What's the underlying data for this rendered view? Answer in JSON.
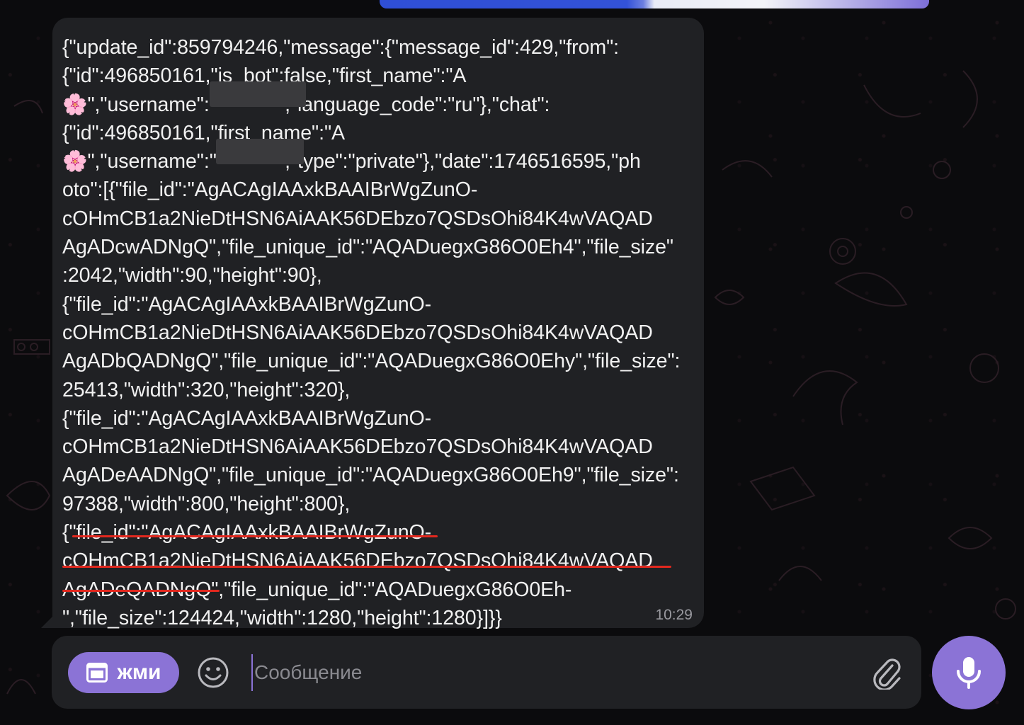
{
  "chat": {
    "message": {
      "lines": [
        "{\"update_id\":859794246,\"message\":{\"message_id\":429,\"from\":",
        "{\"id\":496850161,\"is_bot\":false,\"first_name\":\"A",
        "🌸\",\"username\":\"           \",\"language_code\":\"ru\"},\"chat\":",
        "{\"id\":496850161,\"first_name\":\"A",
        "🌸\",\"username\":\"           \",\"type\":\"private\"},\"date\":1746516595,\"ph",
        "oto\":[{\"file_id\":\"AgACAgIAAxkBAAIBrWgZunO-",
        "cOHmCB1a2NieDtHSN6AiAAK56DEbzo7QSDsOhi84K4wVAQAD",
        "AgADcwADNgQ\",\"file_unique_id\":\"AQADuegxG86O0Eh4\",\"file_size\"",
        ":2042,\"width\":90,\"height\":90},",
        "{\"file_id\":\"AgACAgIAAxkBAAIBrWgZunO-",
        "cOHmCB1a2NieDtHSN6AiAAK56DEbzo7QSDsOhi84K4wVAQAD",
        "AgADbQADNgQ\",\"file_unique_id\":\"AQADuegxG86O0Ehy\",\"file_size\":",
        "25413,\"width\":320,\"height\":320},",
        "{\"file_id\":\"AgACAgIAAxkBAAIBrWgZunO-",
        "cOHmCB1a2NieDtHSN6AiAAK56DEbzo7QSDsOhi84K4wVAQAD",
        "AgADeAADNgQ\",\"file_unique_id\":\"AQADuegxG86O0Eh9\",\"file_size\":",
        "97388,\"width\":800,\"height\":800},",
        "{\"file_id\":\"AgACAgIAAxkBAAIBrWgZunO-",
        "cOHmCB1a2NieDtHSN6AiAAK56DEbzo7QSDsOhi84K4wVAQAD",
        "AgADeQADNgQ\",\"file_unique_id\":\"AQADuegxG86O0Eh-",
        "\",\"file_size\":124424,\"width\":1280,\"height\":1280}]}}"
      ],
      "time": "10:29"
    }
  },
  "composer": {
    "bot_menu_label": "жми",
    "placeholder": "Сообщение"
  },
  "icons": {
    "menu": "window-square-icon",
    "emoji": "smiley-icon",
    "attach": "paperclip-icon",
    "mic": "microphone-icon"
  },
  "colors": {
    "accent": "#8b73d6",
    "bubble": "#202124",
    "background": "#0b0b0d",
    "highlight_underline": "#e2281e"
  }
}
